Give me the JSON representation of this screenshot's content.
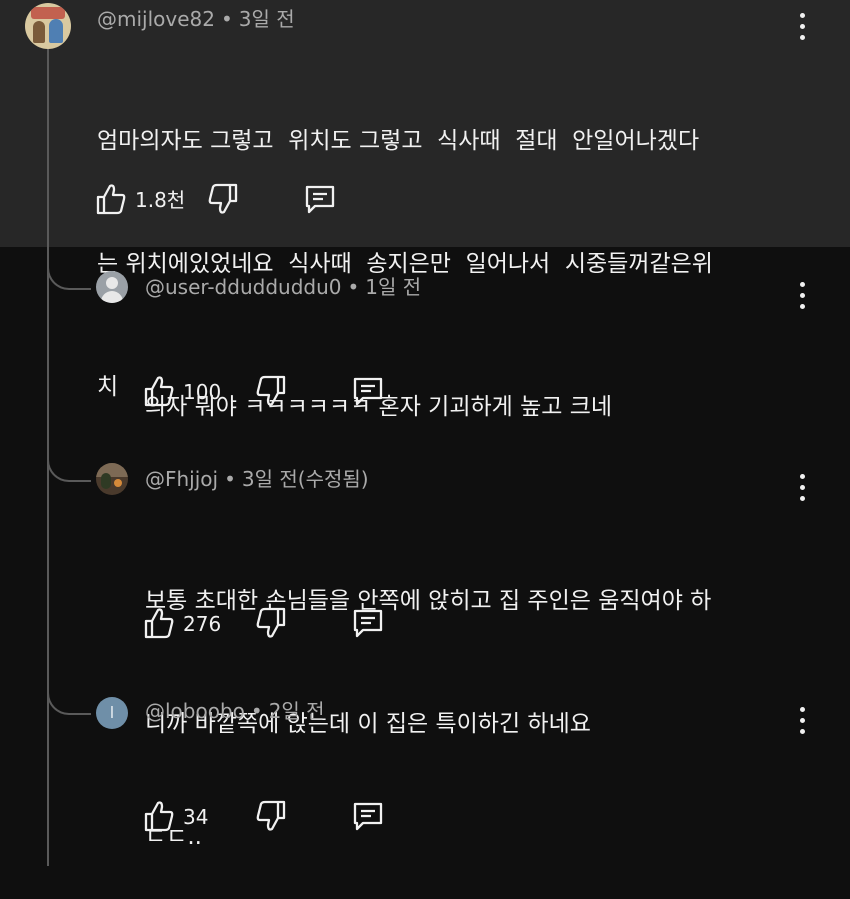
{
  "comments": [
    {
      "handle": "@mijlove82",
      "time": "3일 전",
      "lines": [
        "엄마의자도 그렇고  위치도 그렇고  식사때  절대  안일어나겠다",
        "는 위치에있었네요  식사때  송지은만  일어나서  시중들꺼같은위",
        "치"
      ],
      "likes": "1.8천"
    },
    {
      "handle": "@user-ddudduddu0",
      "time": "1일 전",
      "lines": [
        "의자 뭐야 ㅋㅋㅋㅋㅋㅋ 혼자 기괴하게 높고 크네"
      ],
      "likes": "100"
    },
    {
      "handle": "@Fhjjoj",
      "time": "3일 전(수정됨)",
      "lines": [
        "보통 초대한 손님들을 안쪽에 앉히고 집 주인은 움직여야 하",
        "니까 바깥쪽에 앉는데 이 집은 특이하긴 하네요"
      ],
      "likes": "276"
    },
    {
      "handle": "@loboobo",
      "avatar_letter": "l",
      "time": "2일 전",
      "lines": [
        "ㄷㄷ.."
      ],
      "likes": "34"
    }
  ],
  "separator": "•",
  "icons": [
    "thumb-up-icon",
    "thumb-down-icon",
    "reply-icon",
    "more-vert-icon"
  ],
  "colors": {
    "top_background": "#272727",
    "background": "#0f0f0f",
    "text": "#f1f1f1",
    "meta": "#aaaaaa"
  }
}
